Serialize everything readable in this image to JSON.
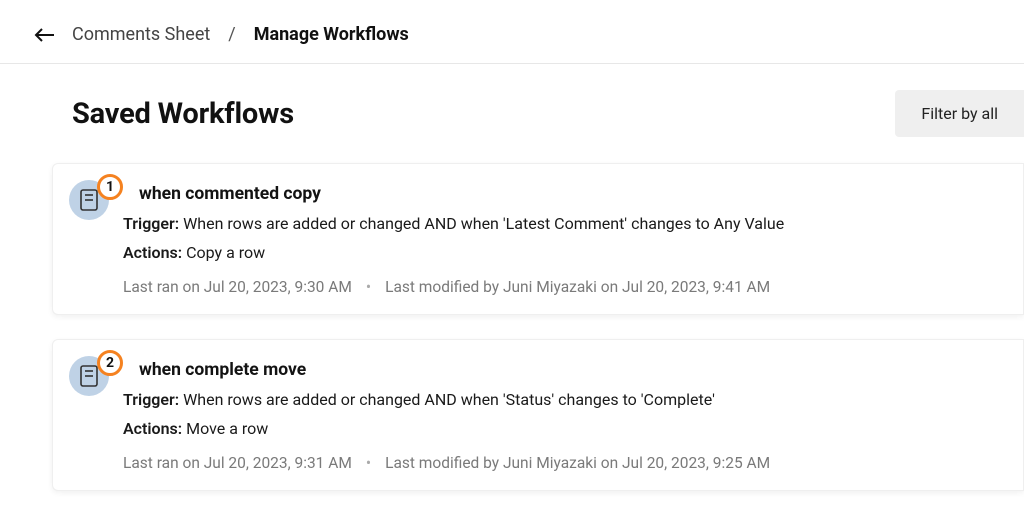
{
  "breadcrumb": {
    "parent": "Comments Sheet",
    "separator": "/",
    "current": "Manage Workflows"
  },
  "header": {
    "title": "Saved Workflows",
    "filter_label": "Filter by all"
  },
  "labels": {
    "trigger": "Trigger:",
    "actions": "Actions:"
  },
  "workflows": [
    {
      "index": "1",
      "name": "when commented copy",
      "trigger": "When rows are added or changed AND when 'Latest Comment' changes to Any Value",
      "actions": "Copy a row",
      "last_ran": "Last ran on Jul 20, 2023, 9:30 AM",
      "last_modified": "Last modified by Juni Miyazaki on Jul 20, 2023, 9:41 AM"
    },
    {
      "index": "2",
      "name": "when complete move",
      "trigger": "When rows are added or changed AND when 'Status' changes to 'Complete'",
      "actions": "Move a row",
      "last_ran": "Last ran on Jul 20, 2023, 9:31 AM",
      "last_modified": "Last modified by Juni Miyazaki on Jul 20, 2023, 9:25 AM"
    }
  ]
}
